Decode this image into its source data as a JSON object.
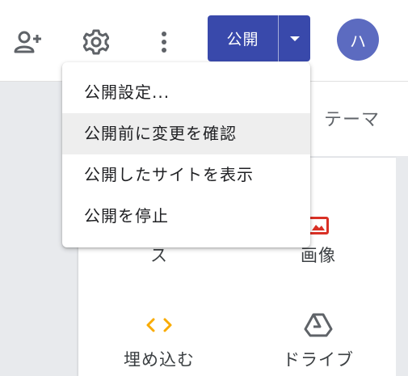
{
  "toolbar": {
    "add_person_icon": "person-add-icon",
    "settings_icon": "gear-icon",
    "more_icon": "more-vert-icon",
    "publish_label": "公開",
    "publish_dropdown_icon": "caret-down-icon",
    "avatar_initial": "ハ",
    "colors": {
      "publish": "#3949ab",
      "avatar": "#5c6bc0"
    }
  },
  "tabs": {
    "theme_label": "テーマ"
  },
  "insert_panel": {
    "items": [
      {
        "label": "ス",
        "icon": ""
      },
      {
        "label": "画像",
        "icon": "image-icon"
      },
      {
        "label": "埋め込む",
        "icon": "embed-code-icon"
      },
      {
        "label": "ドライブ",
        "icon": "drive-icon"
      }
    ],
    "colors": {
      "image_icon": "#d93025",
      "embed_icon": "#f9ab00",
      "drive_icon": "#5f6368"
    }
  },
  "publish_menu": {
    "items": [
      {
        "label": "公開設定..."
      },
      {
        "label": "公開前に変更を確認"
      },
      {
        "label": "公開したサイトを表示"
      },
      {
        "label": "公開を停止"
      }
    ],
    "hovered_index": 1
  }
}
